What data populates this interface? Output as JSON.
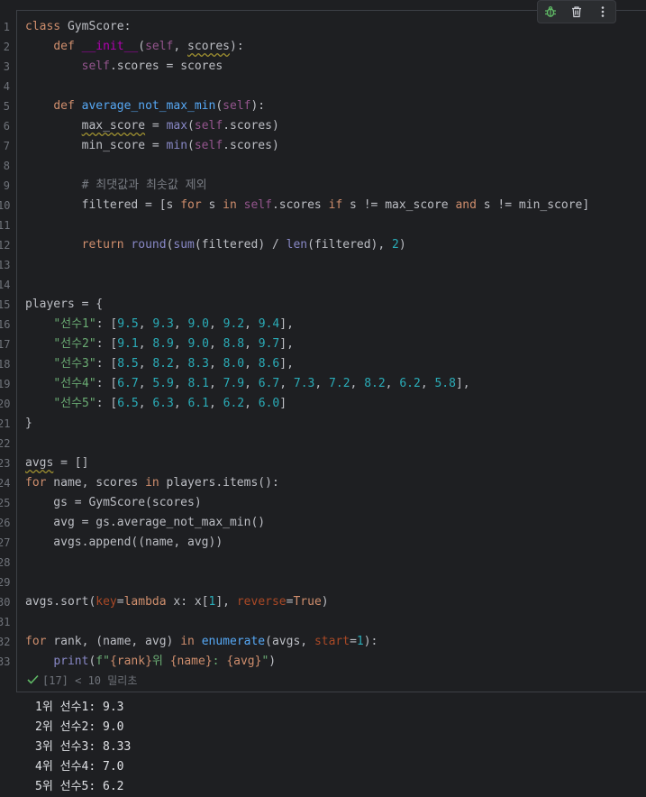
{
  "gutter": {
    "line_numbers": [
      "1",
      "2",
      "3",
      "4",
      "5",
      "6",
      "7",
      "8",
      "9",
      "10",
      "11",
      "12",
      "13",
      "14",
      "15",
      "16",
      "17",
      "18",
      "19",
      "20",
      "21",
      "22",
      "23",
      "24",
      "25",
      "26",
      "27",
      "28",
      "29",
      "30",
      "31",
      "32",
      "33"
    ]
  },
  "code": {
    "l1": [
      "class",
      " GymScore:"
    ],
    "l2": [
      "    ",
      "def",
      " ",
      "__init__",
      "(",
      "self",
      ", ",
      "scores",
      "):"
    ],
    "l3": [
      "        ",
      "self",
      ".scores = scores"
    ],
    "l5": [
      "    ",
      "def",
      " ",
      "average_not_max_min",
      "(",
      "self",
      "):"
    ],
    "l6": [
      "        ",
      "max_score",
      " = ",
      "max",
      "(",
      "self",
      ".scores)"
    ],
    "l7": [
      "        min_score = ",
      "min",
      "(",
      "self",
      ".scores)"
    ],
    "l9": [
      "        ",
      "# 최댓값과 최솟값 제외"
    ],
    "l10": [
      "        filtered = [s ",
      "for",
      " s ",
      "in",
      " ",
      "self",
      ".scores ",
      "if",
      " s != max_score ",
      "and",
      " s != min_score]"
    ],
    "l12": [
      "        ",
      "return",
      " ",
      "round",
      "(",
      "sum",
      "(filtered) / ",
      "len",
      "(filtered), ",
      "2",
      ")"
    ],
    "l15": [
      "players = {"
    ],
    "l16": [
      "    ",
      "\"선수1\"",
      ": [",
      "9.5",
      ", ",
      "9.3",
      ", ",
      "9.0",
      ", ",
      "9.2",
      ", ",
      "9.4",
      "],"
    ],
    "l17": [
      "    ",
      "\"선수2\"",
      ": [",
      "9.1",
      ", ",
      "8.9",
      ", ",
      "9.0",
      ", ",
      "8.8",
      ", ",
      "9.7",
      "],"
    ],
    "l18": [
      "    ",
      "\"선수3\"",
      ": [",
      "8.5",
      ", ",
      "8.2",
      ", ",
      "8.3",
      ", ",
      "8.0",
      ", ",
      "8.6",
      "],"
    ],
    "l19": [
      "    ",
      "\"선수4\"",
      ": [",
      "6.7",
      ", ",
      "5.9",
      ", ",
      "8.1",
      ", ",
      "7.9",
      ", ",
      "6.7",
      ", ",
      "7.3",
      ", ",
      "7.2",
      ", ",
      "8.2",
      ", ",
      "6.2",
      ", ",
      "5.8",
      "],"
    ],
    "l20": [
      "    ",
      "\"선수5\"",
      ": [",
      "6.5",
      ", ",
      "6.3",
      ", ",
      "6.1",
      ", ",
      "6.2",
      ", ",
      "6.0",
      "]"
    ],
    "l21": [
      "}"
    ],
    "l23": [
      "avgs",
      " = []"
    ],
    "l24": [
      "for",
      " name, scores ",
      "in",
      " players.items():"
    ],
    "l25": [
      "    gs = GymScore(scores)"
    ],
    "l26": [
      "    avg = gs.average_not_max_min()"
    ],
    "l27": [
      "    avgs.append((name, avg))"
    ],
    "l30": [
      "avgs.sort(",
      "key",
      "=",
      "lambda",
      " x: x[",
      "1",
      "], ",
      "reverse",
      "=",
      "True",
      ")"
    ],
    "l32": [
      "for",
      " rank, (name, avg) ",
      "in",
      " ",
      "enumerate",
      "(avgs, ",
      "start",
      "=",
      "1",
      "):"
    ],
    "l33": [
      "    ",
      "print",
      "(",
      "f\"",
      "{rank}",
      "위 ",
      "{name}",
      ": ",
      "{avg}",
      "\"",
      ")"
    ]
  },
  "status": {
    "text": "[17] < 10 밀리초"
  },
  "output": {
    "lines": [
      "1위 선수1: 9.3",
      "2위 선수2: 9.0",
      "3위 선수3: 8.33",
      "4위 선수4: 7.0",
      "5위 선수5: 6.2"
    ]
  },
  "toolbar": {
    "icons": [
      "bug-icon",
      "trash-icon",
      "more-vertical-icon"
    ]
  },
  "colors": {
    "background": "#1e1f22",
    "keyword": "#cf8e6d",
    "function": "#56a8f5",
    "self": "#94558d",
    "number": "#2aacb8",
    "string": "#6aab73",
    "comment": "#7a7e85",
    "param_kw": "#aa4926",
    "success": "#5fb865"
  }
}
